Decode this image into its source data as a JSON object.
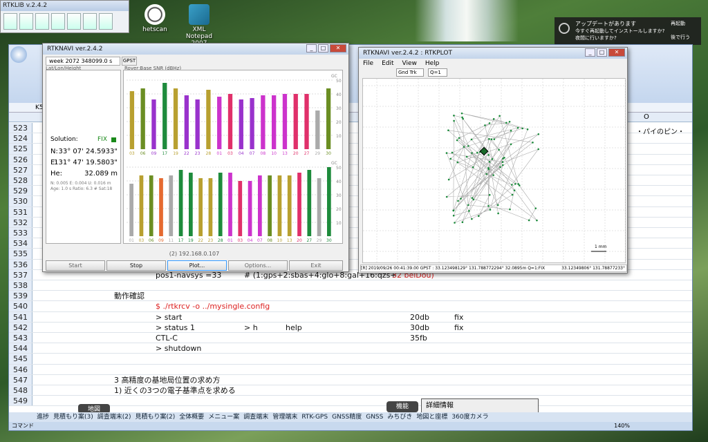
{
  "desktop": {
    "icons": [
      {
        "label": "hetscan"
      },
      {
        "label": "XML Notepad 2007"
      }
    ]
  },
  "launcher": {
    "title": "RTKLIB v.2.4.2"
  },
  "notification": {
    "title": "アップデートがあります",
    "body": "今すぐ再起動してインストールしますか? 夜間に行いますか?",
    "restart": "再起動",
    "later": "後で行う"
  },
  "excel": {
    "cellref": "K5",
    "col_o": "O",
    "row_note": "・パイのピン・",
    "rows": [
      {
        "n": "523"
      },
      {
        "n": "524"
      },
      {
        "n": "525"
      },
      {
        "n": "526"
      },
      {
        "n": "527"
      },
      {
        "n": "528"
      },
      {
        "n": "529"
      },
      {
        "n": "530"
      },
      {
        "n": "531"
      },
      {
        "n": "532"
      },
      {
        "n": "533"
      },
      {
        "n": "534"
      },
      {
        "n": "535"
      },
      {
        "n": "536"
      },
      {
        "n": "537",
        "c1": "pos1-navsys       =33",
        "c2": "# (1:gps+2:sbas+4:glo+8:gal+16:qzs+",
        "c3": "32 beiDou)"
      },
      {
        "n": "538"
      },
      {
        "n": "539",
        "c0": "動作確認"
      },
      {
        "n": "540",
        "c1": "$ ./rtkrcv -o ../mysingle.config"
      },
      {
        "n": "541",
        "c1": "> start",
        "d1": "20db",
        "d2": "fix"
      },
      {
        "n": "542",
        "c1": "> status 1",
        "c2": "> h",
        "c3": "help",
        "d1": "30db",
        "d2": "fix"
      },
      {
        "n": "543",
        "c1": "CTL-C",
        "d1": "35fb"
      },
      {
        "n": "544",
        "c1": "> shutdown"
      },
      {
        "n": "545"
      },
      {
        "n": "546"
      },
      {
        "n": "547",
        "c0": "3 高精度の基地局位置の求め方"
      },
      {
        "n": "548",
        "c0": "1) 近くの3つの電子基準点を求める"
      },
      {
        "n": "549"
      }
    ],
    "detail_label": "詳細情報",
    "map_label": "地図",
    "func_label": "機能",
    "sheet_tabs": [
      "進捗",
      "見積もり案(3)",
      "調査端末(2)",
      "見積もり案(2)",
      "全体概要",
      "メニュー案",
      "調査端末",
      "管理端末",
      "RTK-GPS",
      "GNSS精度",
      "GNSS",
      "みちびき",
      "地図と座標",
      "360度カメラ"
    ],
    "status": "コマンド",
    "zoom": "140%"
  },
  "navi": {
    "title": "RTKNAVI ver.2.4.2",
    "week": "week 2072 348099.0 s",
    "timesys": "GPST",
    "mode": "Lat/Lon/Height",
    "snr_mode": "Rover:Base SNR (dBHz)",
    "solution_label": "Solution:",
    "solution": "FIX",
    "lat_label": "N:",
    "lat": "33° 07' 24.5933\"",
    "lon_label": "E:",
    "lon": "131° 47' 19.5803\"",
    "hgt_label": "He:",
    "hgt": "32.089 m",
    "stats1": "N: 0.005 E: 0.004 U: 0.016 m",
    "stats2": "Age: 1.0 s Ratio: 6.3 # Sat:18",
    "ip": "(2) 192.168.0.107",
    "btn_start": "Start",
    "btn_stop": "Stop",
    "btn_plot": "Plot...",
    "btn_options": "Options...",
    "btn_exit": "Exit",
    "gc": "GC",
    "sats_top": [
      "03",
      "06",
      "09",
      "17",
      "19",
      "22",
      "23",
      "28",
      "01",
      "03",
      "04",
      "07",
      "08",
      "10",
      "13",
      "20",
      "27",
      "29",
      "30"
    ],
    "snr_top": [
      42,
      44,
      36,
      48,
      44,
      39,
      36,
      43,
      38,
      40,
      36,
      37,
      39,
      39,
      40,
      40,
      40,
      28,
      44
    ],
    "col_top": [
      "#b8a030",
      "#6b8e23",
      "#9932cc",
      "#1e8b3c",
      "#b8a030",
      "#9932cc",
      "#9932cc",
      "#b8a030",
      "#cc33cc",
      "#e0306a",
      "#9932cc",
      "#9932cc",
      "#cc33cc",
      "#cc33cc",
      "#cc33cc",
      "#e0306a",
      "#e0306a",
      "#aaaaaa",
      "#6b8e23"
    ],
    "sats_bot": [
      "01",
      "03",
      "06",
      "09",
      "11",
      "17",
      "19",
      "22",
      "23",
      "28",
      "01",
      "03",
      "04",
      "07",
      "08",
      "10",
      "13",
      "20",
      "27",
      "29",
      "30"
    ],
    "snr_bot": [
      38,
      44,
      44,
      42,
      44,
      48,
      46,
      42,
      42,
      46,
      46,
      40,
      40,
      44,
      44,
      44,
      44,
      46,
      48,
      42,
      50
    ],
    "col_bot": [
      "#aaaaaa",
      "#b8a030",
      "#6b8e23",
      "#e56a30",
      "#aaaaaa",
      "#1e8b3c",
      "#1e8b3c",
      "#b8a030",
      "#b8a030",
      "#1e8b3c",
      "#cc33cc",
      "#e0306a",
      "#cc33cc",
      "#cc33cc",
      "#6b8e23",
      "#b8a030",
      "#b8a030",
      "#e0306a",
      "#1e8b3c",
      "#aaaaaa",
      "#1e8b3c"
    ],
    "ticks": [
      "50",
      "40",
      "30",
      "20",
      "10"
    ]
  },
  "plot": {
    "title": "RTKNAVI ver.2.4.2 : RTKPLOT",
    "menu": [
      "File",
      "Edit",
      "View",
      "Help"
    ],
    "plot_type": "Gnd Trk",
    "quality": "Q=1",
    "scale": "1 mm",
    "status_left": "[R] 2019/09/26 00:41:39.00 GPST : 33.123498129° 131.788772294° 32.0895m Q=1:FIX",
    "status_right": "33.12349806° 131.78877233°"
  }
}
